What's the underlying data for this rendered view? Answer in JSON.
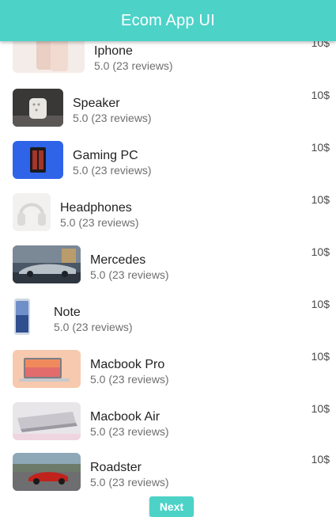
{
  "app_bar": {
    "title": "Ecom App UI"
  },
  "products": [
    {
      "name": "Iphone",
      "rating": "5.0 (23 reviews)",
      "price": "10$"
    },
    {
      "name": "Speaker",
      "rating": "5.0 (23 reviews)",
      "price": "10$"
    },
    {
      "name": "Gaming PC",
      "rating": "5.0 (23 reviews)",
      "price": "10$"
    },
    {
      "name": "Headphones",
      "rating": "5.0 (23 reviews)",
      "price": "10$"
    },
    {
      "name": "Mercedes",
      "rating": "5.0 (23 reviews)",
      "price": "10$"
    },
    {
      "name": "Note",
      "rating": "5.0 (23 reviews)",
      "price": "10$"
    },
    {
      "name": "Macbook Pro",
      "rating": "5.0 (23 reviews)",
      "price": "10$"
    },
    {
      "name": "Macbook Air",
      "rating": "5.0 (23 reviews)",
      "price": "10$"
    },
    {
      "name": "Roadster",
      "rating": "5.0 (23 reviews)",
      "price": "10$"
    }
  ],
  "pagination": {
    "next_label": "Next"
  },
  "colors": {
    "accent": "#4dd2c8",
    "title_text": "#ffffff",
    "price_text": "#4b4b4b"
  }
}
